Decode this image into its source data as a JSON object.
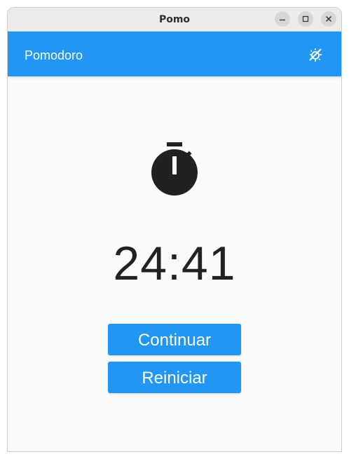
{
  "window": {
    "title": "Pomo",
    "controls": [
      "minimize",
      "maximize",
      "close"
    ]
  },
  "appbar": {
    "title": "Pomodoro",
    "theme_icon": "brightness-toggle-icon",
    "color": "#2196f3"
  },
  "timer": {
    "icon": "stopwatch-icon",
    "display": "24:41"
  },
  "actions": {
    "continue_label": "Continuar",
    "reset_label": "Reiniciar"
  }
}
